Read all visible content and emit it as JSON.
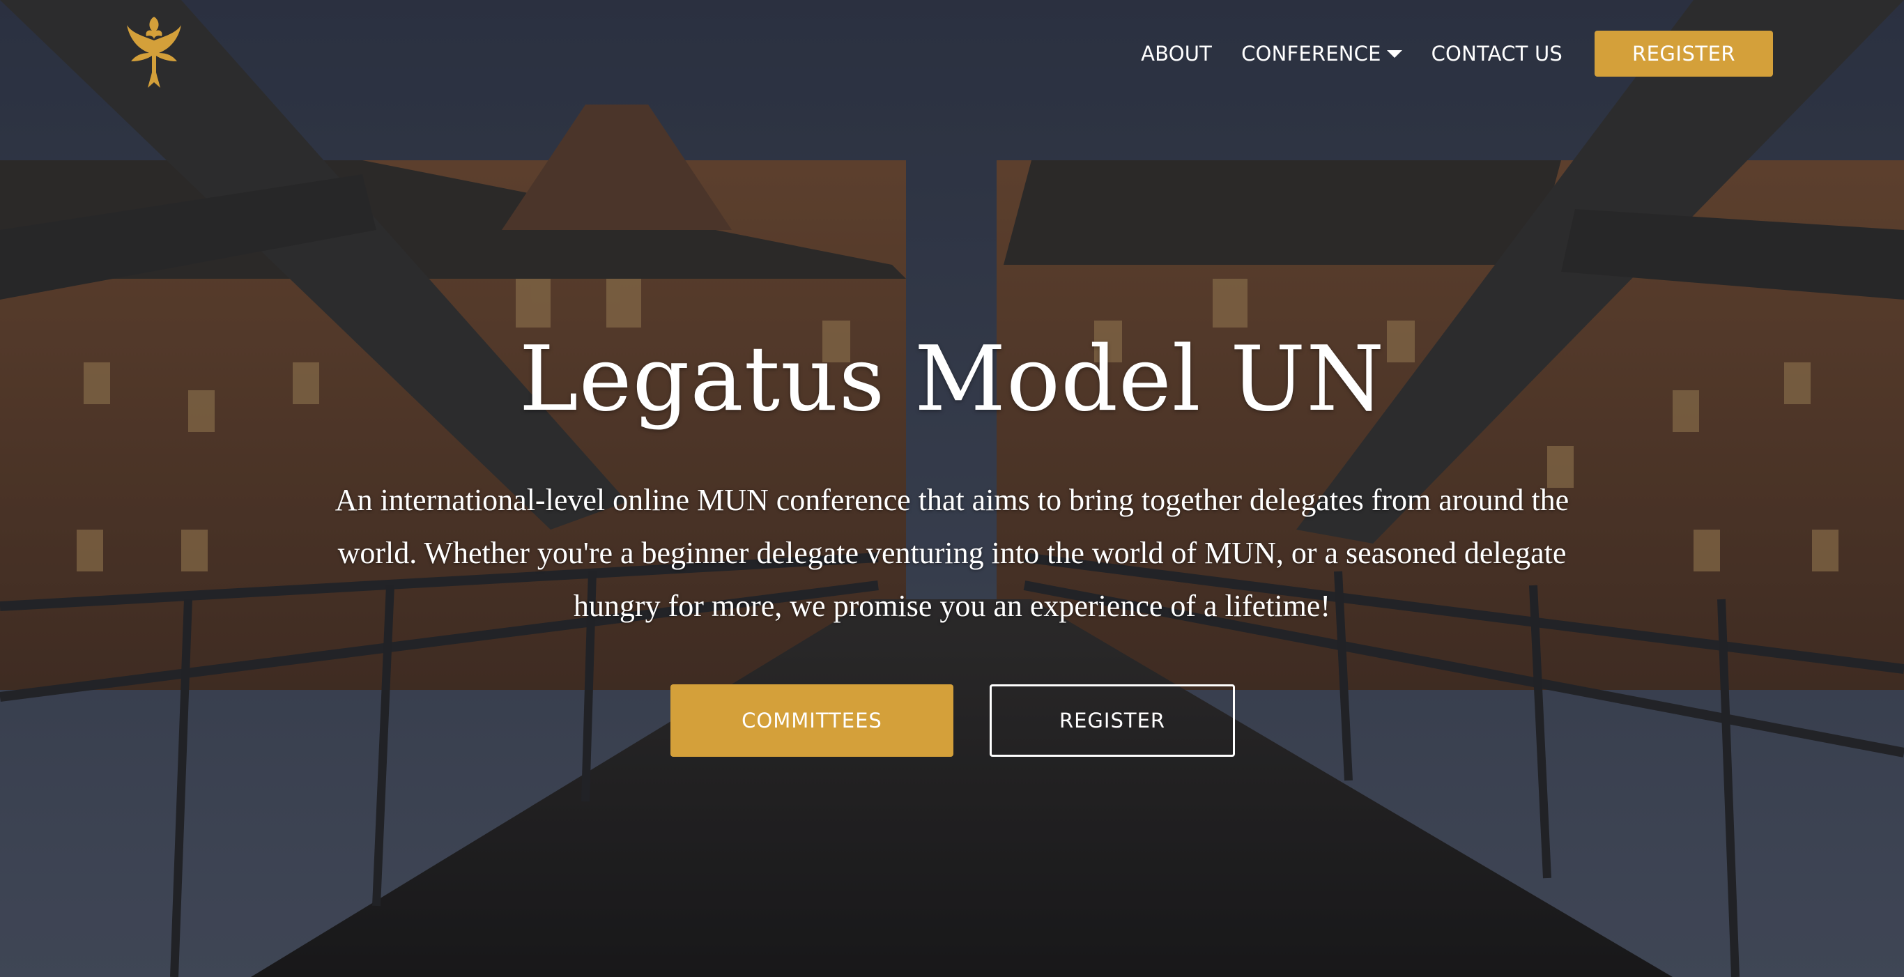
{
  "nav": {
    "about": "ABOUT",
    "conference": "CONFERENCE",
    "contact": "CONTACT US",
    "register": "REGISTER"
  },
  "hero": {
    "title": "Legatus Model UN",
    "tagline": "An international-level online MUN conference that aims to bring together delegates from around the world. Whether you're a beginner delegate venturing into the world of MUN, or a seasoned delegate hungry for more, we promise you an experience of a lifetime!",
    "committees_button": "COMMITTEES",
    "register_button": "REGISTER"
  },
  "colors": {
    "accent": "#d4a03a",
    "text": "#ffffff"
  },
  "icons": {
    "logo": "phoenix-logo-icon",
    "dropdown": "caret-down-icon"
  }
}
